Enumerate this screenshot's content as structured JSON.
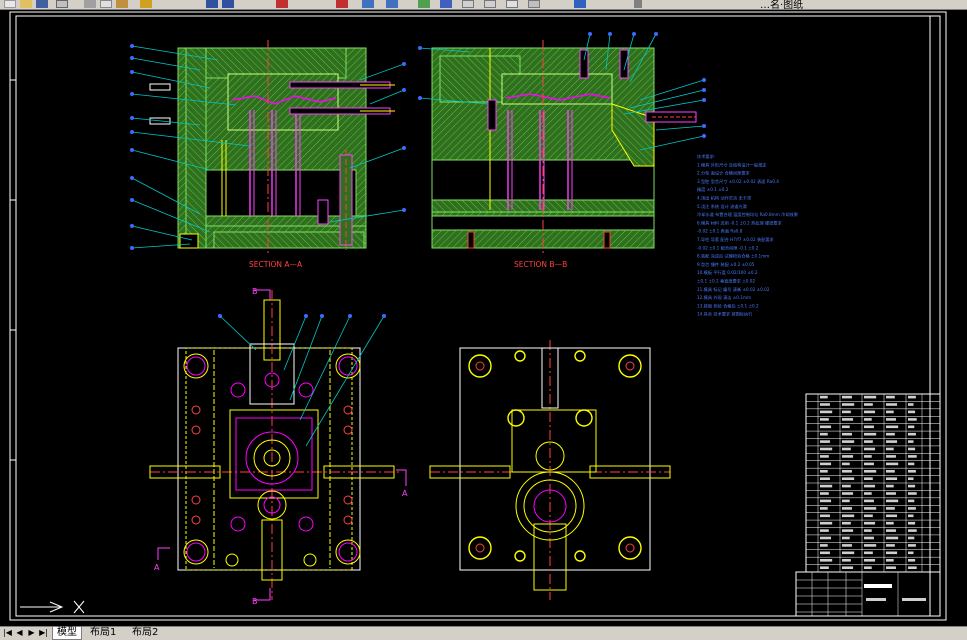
{
  "toolbar": {
    "title_fragment": "…名·图纸"
  },
  "drawing": {
    "section_a_label": "SECTION A—A",
    "section_b_label": "SECTION B—B",
    "marker_a": "A",
    "marker_b": "B",
    "colors": {
      "background": "#000000",
      "frame": "#ffffff",
      "mold_fill": "#2f6f1f",
      "hatch": "#3fa32a",
      "part": "#ff00ff",
      "yellow": "#ffff00",
      "cyan_leader": "#00c8c8",
      "blue_leader": "#3a6bff",
      "section_text": "#ff4040",
      "notes": "#4b7bff",
      "center_line": "#ff0000"
    },
    "notes_lines": [
      "技术要求:",
      "1.模具  外形尺寸 及结构设计一般规定",
      "2.分型  面设计  合模间隙要求",
      "3.型腔  型芯尺寸 ±0.02  ±0.02  表面  Ra0.4",
      "   精度  ±0.1 ±0.2",
      "4.顶出  机构  动作灵活  无卡滞",
      "5.浇注  系统  设计  流道光滑",
      "   冷却水道 布置合理 温度控制均匀 Ra0.8mm 冷却效果",
      "6.模具  材料  选用 -0.1 ±0.2  热处理 硬度要求",
      "   -0.02 ±0.1  表面 Ra0.8",
      "7.导柱  导套  配合  H7/f7 ±0.02 装配要求",
      "   -0.02 ±0.1  配合间隙 -0.1 ±0.2",
      "8.装配  完成后  试模检验合格 ±0.1mm",
      "9.型芯  镶件  装配 ±0.2 ±0.05",
      "10.模板  平行度  0.02/100 ±0.2",
      "   ±0.1 ±0.2  垂直度要求 ±0.02",
      "11.模具  标记  编号 清晰 ±0.02 ±0.02",
      "12.模具  外观  清洁 ±0.1mm",
      "13.按图  检验  合格后 ±0.1 ±0.2",
      "14.其余  技术要求 按国标执行"
    ]
  },
  "layout_tabs": {
    "nav_buttons": [
      "|◀",
      "◀",
      "▶",
      "▶|"
    ],
    "tabs": [
      "模型",
      "布局1",
      "布局2"
    ],
    "active": "模型"
  }
}
